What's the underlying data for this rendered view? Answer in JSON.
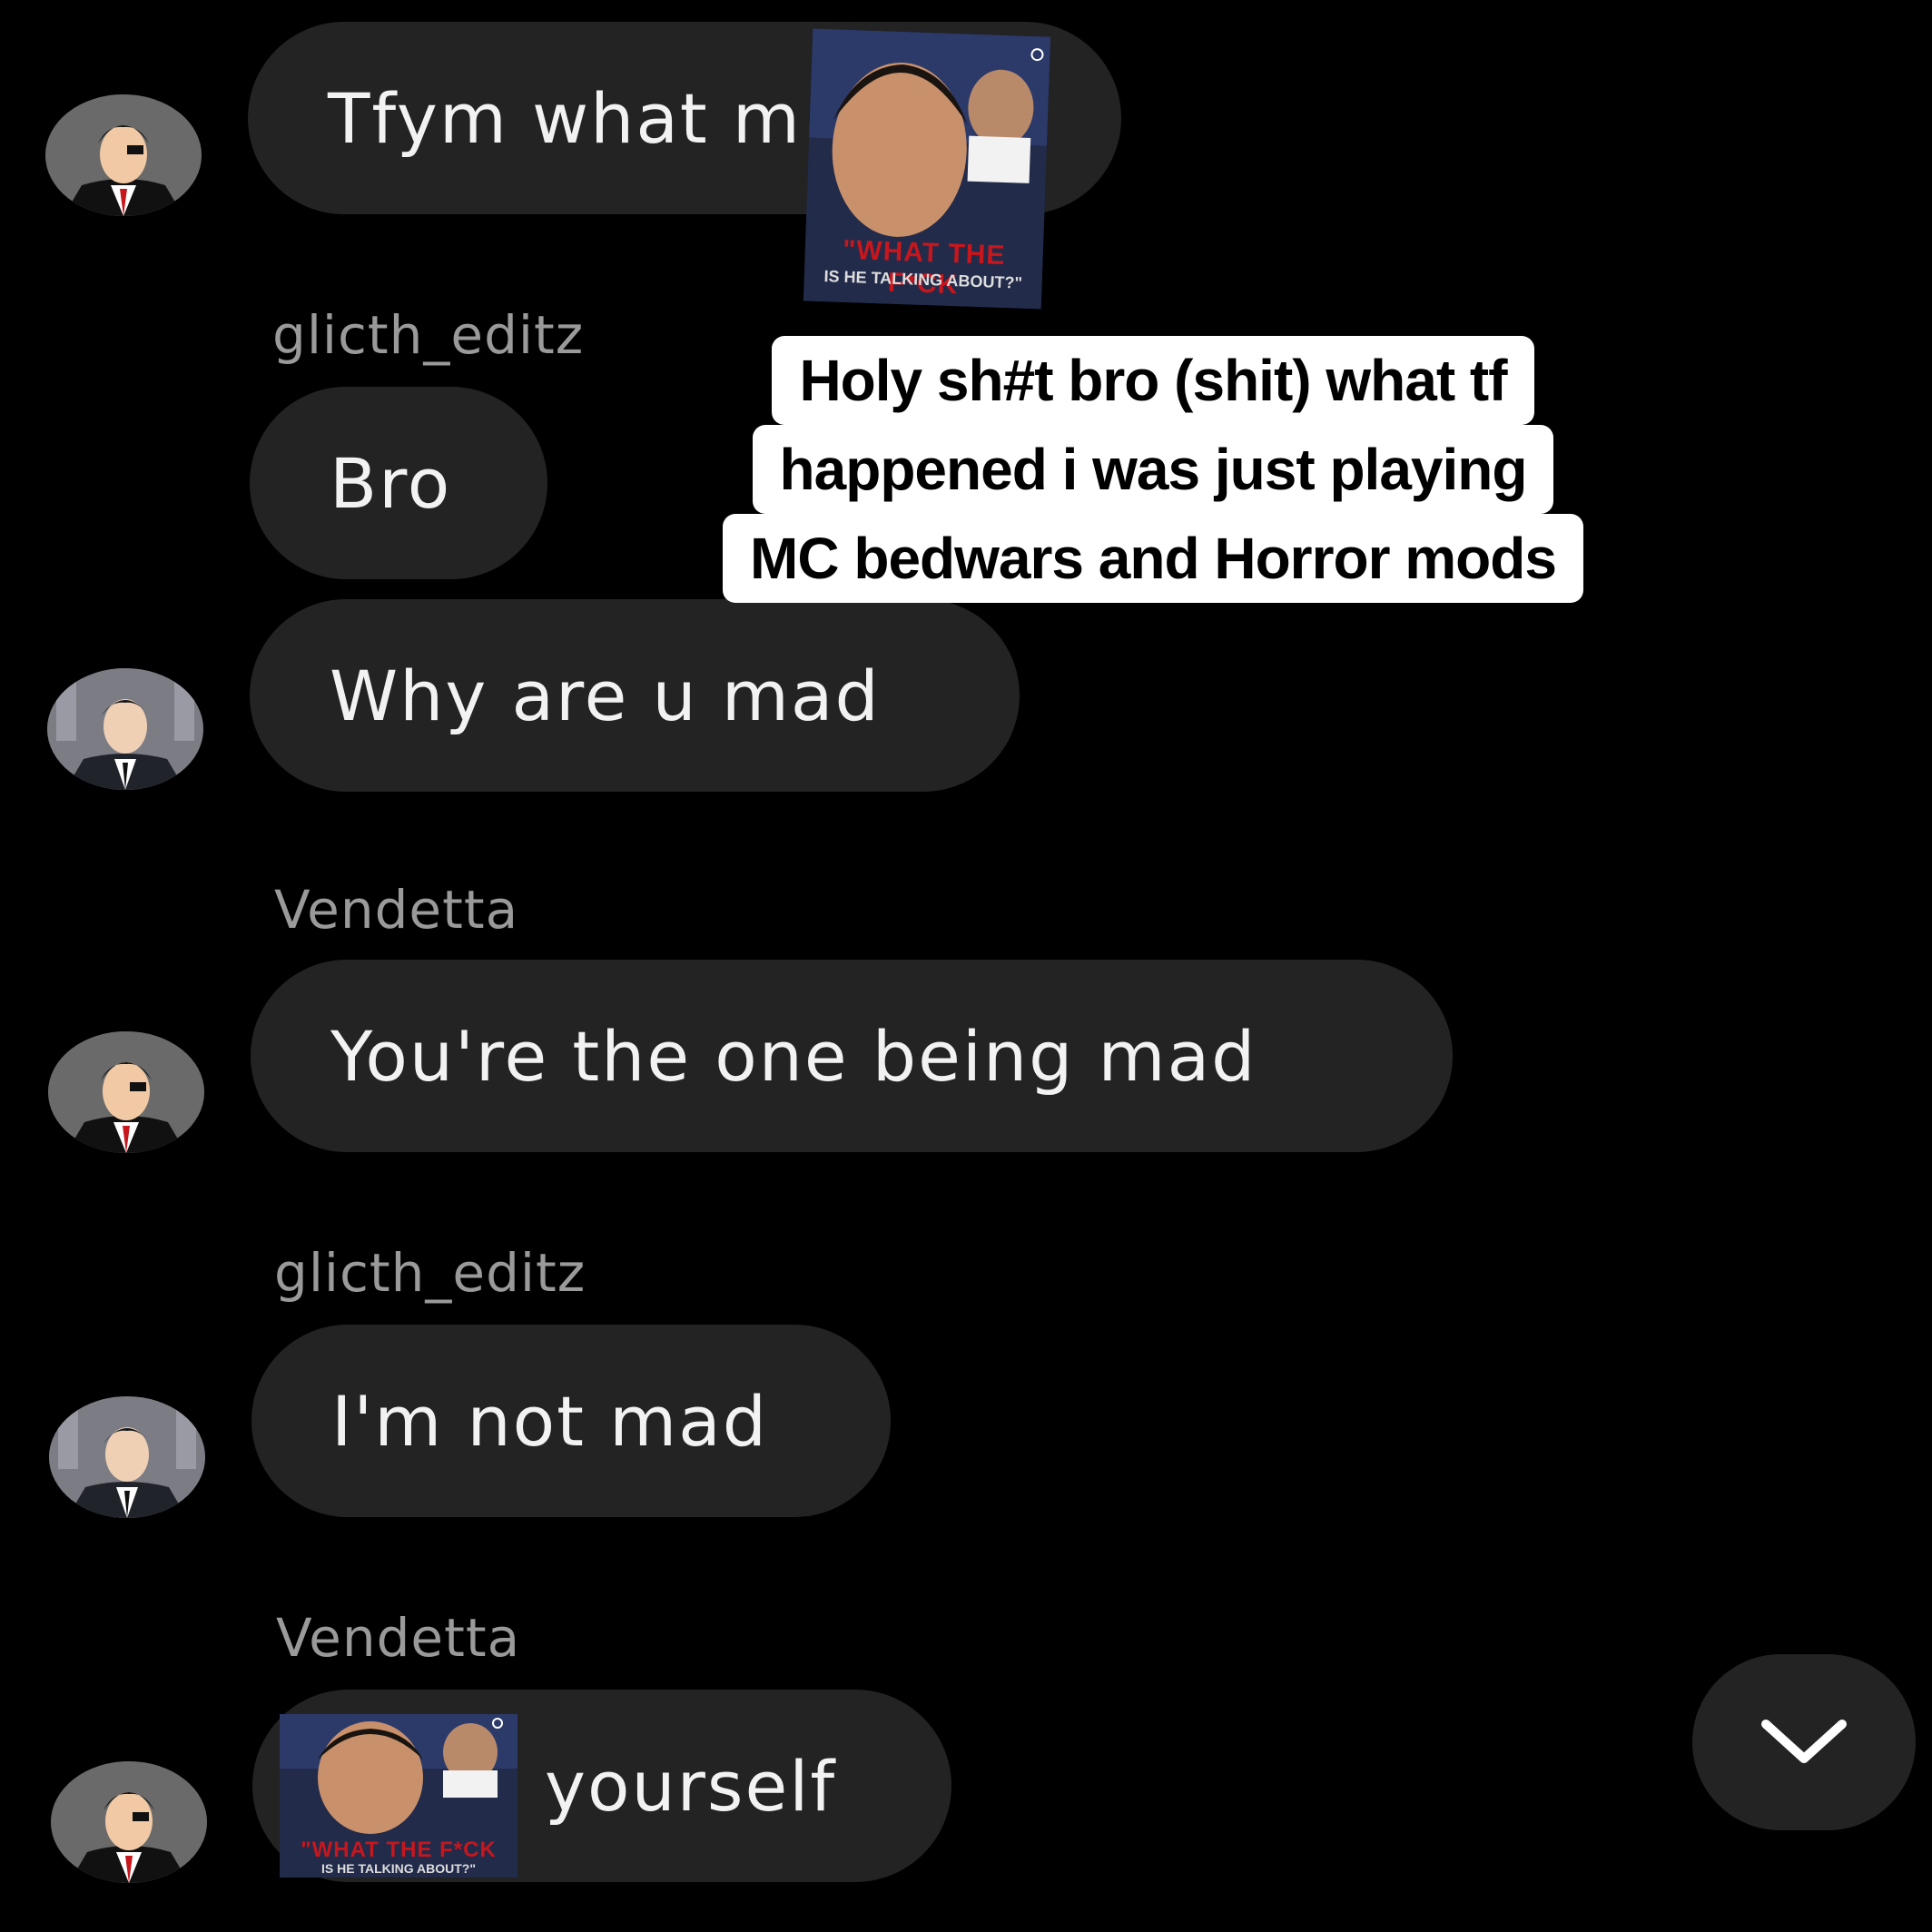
{
  "messages": [
    {
      "sender": "",
      "text": "Tfym what m",
      "avatar": "eyepatch-avatar"
    },
    {
      "sender": "glicth_editz",
      "text": "Bro",
      "avatar": ""
    },
    {
      "sender": "",
      "text": "Why are u mad",
      "avatar": "suit-avatar"
    },
    {
      "sender": "Vendetta",
      "text": "You're the one being mad",
      "avatar": "eyepatch-avatar"
    },
    {
      "sender": "glicth_editz",
      "text": "I'm not mad",
      "avatar": "suit-avatar"
    },
    {
      "sender": "Vendetta",
      "text": "yourself",
      "avatar": "eyepatch-avatar"
    }
  ],
  "caption": {
    "lines": [
      "Holy sh#t bro (shit) what tf",
      "happened i was just playing",
      "MC bedwars and Horror mods"
    ]
  },
  "sticker": {
    "headline": "\"WHAT THE F*CK",
    "subline": "IS HE TALKING ABOUT?\""
  },
  "scroll_button": {
    "icon": "chevron-down-icon"
  }
}
